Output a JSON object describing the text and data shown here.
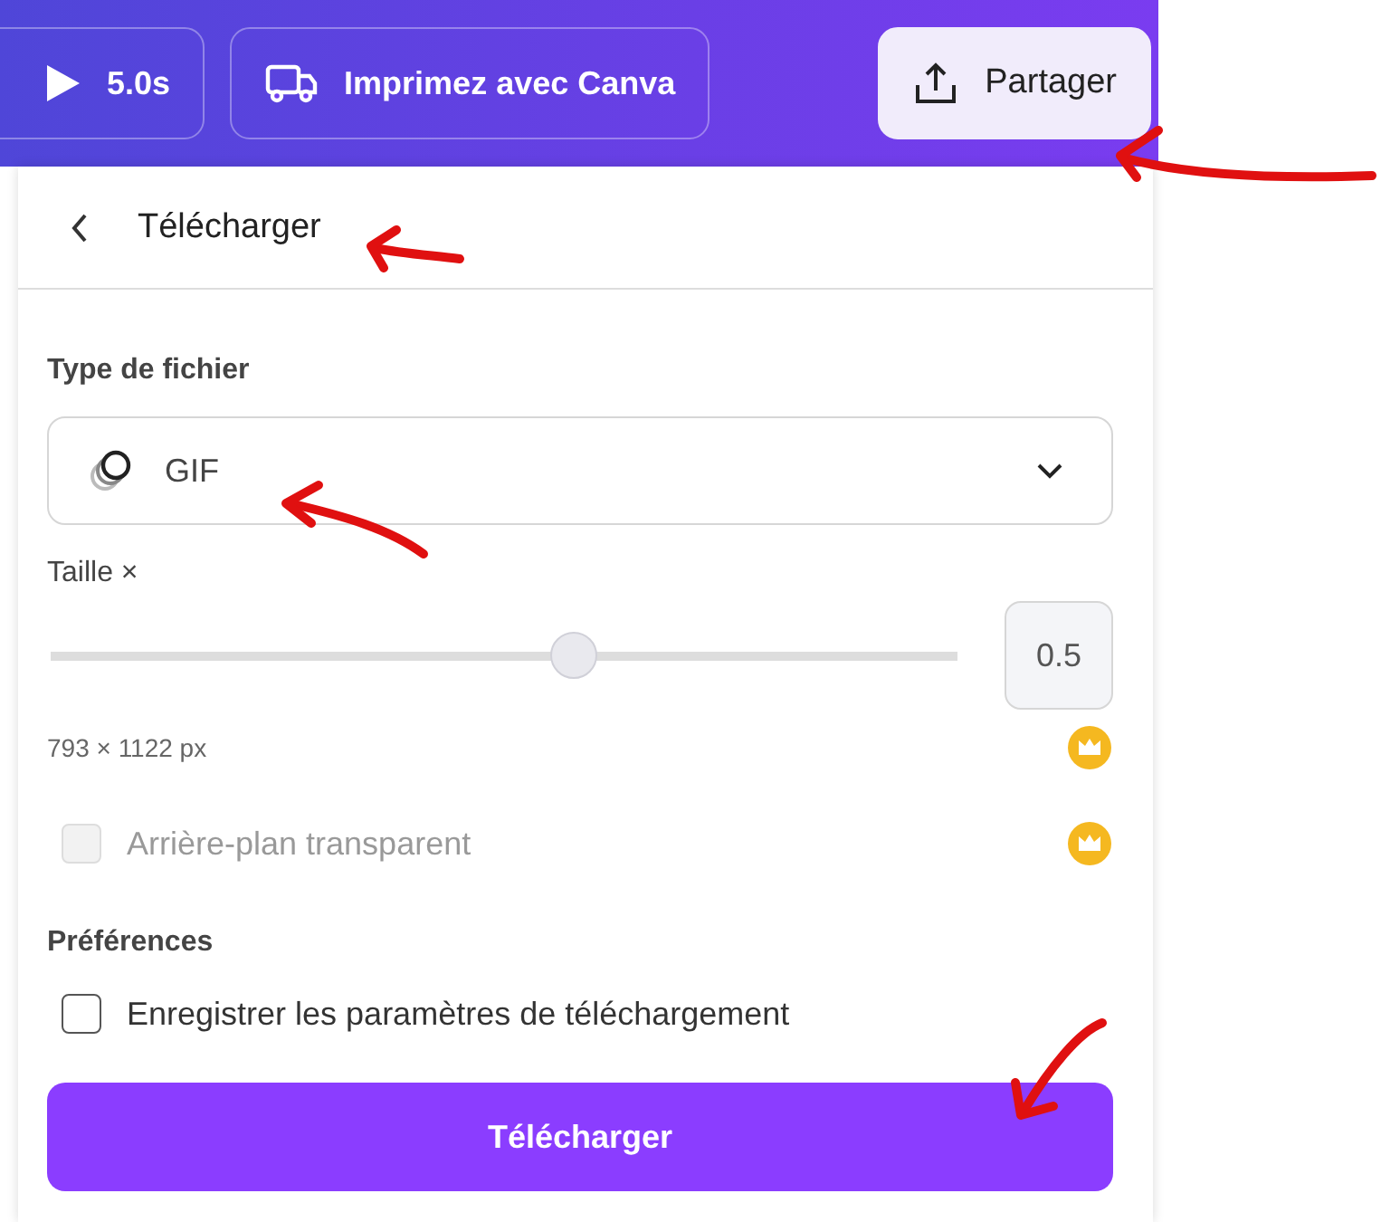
{
  "top_bar": {
    "buttons": [
      {
        "label": "5.0s",
        "highlighted": false
      },
      {
        "label": "Imprimez avec Canva",
        "highlighted": false
      },
      {
        "label": "Partager",
        "highlighted": true
      }
    ]
  },
  "panel": {
    "title": "Télécharger",
    "file_type": {
      "label": "Type de fichier",
      "value": "GIF"
    },
    "size": {
      "label": "Taille ×",
      "level": 0.58,
      "value": "0.5",
      "dimensions": "793 × 1122 px",
      "premium": true
    },
    "transparent_background": {
      "label": "Arrière-plan transparent",
      "checked": false,
      "disabled": true,
      "premium": true
    },
    "preferences": {
      "label": "Préférences"
    },
    "save_settings": {
      "label": "Enregistrer les paramètres de téléchargement",
      "checked": false,
      "disabled": false
    },
    "download_button": "Télécharger"
  }
}
